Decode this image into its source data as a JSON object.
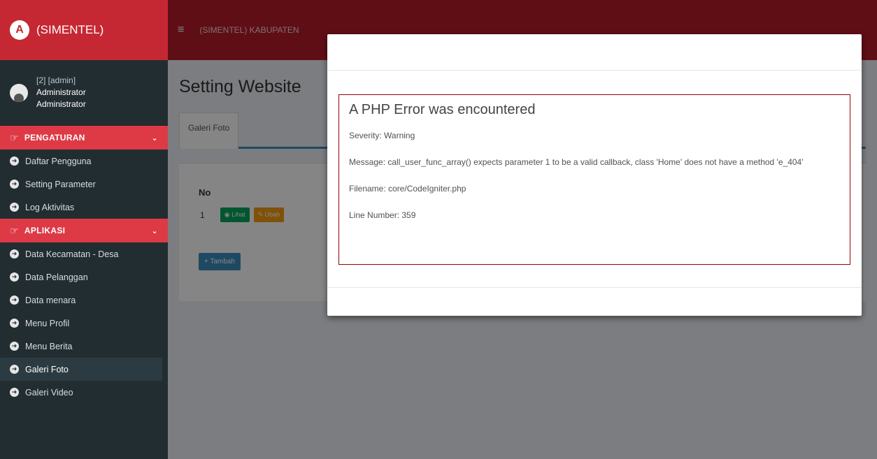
{
  "app": {
    "logo_letter": "A",
    "brand": "(SIMENTEL)",
    "header_title": "(SIMENTEL) KABUPATEN"
  },
  "user": {
    "id_label": "[2] [admin]",
    "name": "Administrator",
    "role": "Administrator"
  },
  "sidebar": {
    "group1": {
      "label": "PENGATURAN",
      "items": [
        "Daftar Pengguna",
        "Setting Parameter",
        "Log Aktivitas"
      ]
    },
    "group2": {
      "label": "APLIKASI",
      "items": [
        "Data Kecamatan - Desa",
        "Data Pelanggan",
        "Data menara",
        "Menu Profil",
        "Menu Berita",
        "Galeri Foto",
        "Galeri Video"
      ]
    },
    "active_item": "Galeri Foto"
  },
  "content": {
    "page_title": "Setting Website",
    "tab_label": "Galeri Foto",
    "table_header_no": "No",
    "row_no": "1",
    "btn_lihat": "Lihat",
    "btn_ubah": "Ubah",
    "btn_tambah": "Tambah"
  },
  "error": {
    "title": "A PHP Error was encountered",
    "severity": "Severity: Warning",
    "message": "Message: call_user_func_array() expects parameter 1 to be a valid callback, class 'Home' does not have a method 'e_404'",
    "filename": "Filename: core/CodeIgniter.php",
    "line": "Line Number: 359"
  },
  "colors": {
    "header_red": "#b71c2b",
    "menu_red": "#dd3a46",
    "sidebar_dark": "#222d32",
    "error_border": "#990000"
  }
}
